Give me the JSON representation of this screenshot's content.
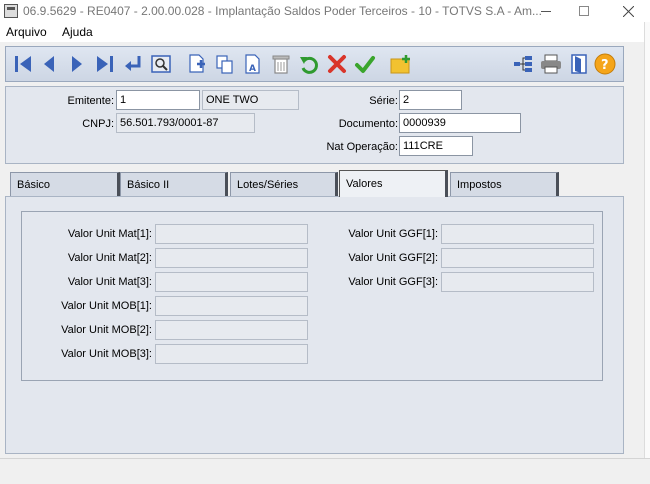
{
  "window": {
    "title": "06.9.5629 - RE0407 - 2.00.00.028 - Implantação Saldos Poder Terceiros - 10 - TOTVS S.A - Am..."
  },
  "menu": {
    "items": [
      "Arquivo",
      "Ajuda"
    ]
  },
  "toolbar": {
    "buttons": [
      "first-icon",
      "previous-icon",
      "next-icon",
      "last-icon",
      "goto-icon",
      "search-icon",
      "new-icon",
      "copy-icon",
      "edit-icon",
      "delete-icon",
      "undo-icon",
      "cancel-icon",
      "save-icon",
      "add-folder-icon",
      "hierarchy-icon",
      "print-icon",
      "exit-icon",
      "help-icon"
    ],
    "colors": {
      "nav": "#3a63b8",
      "undo": "#2f9a2f",
      "cancel": "#d9352a",
      "save": "#3aa52c",
      "help": "#f5a51a"
    }
  },
  "header": {
    "emitente_label": "Emitente:",
    "emitente_value": "1",
    "emitente_name": "ONE TWO",
    "cnpj_label": "CNPJ:",
    "cnpj_value": "56.501.793/0001-87",
    "serie_label": "Série:",
    "serie_value": "2",
    "documento_label": "Documento:",
    "documento_value": "0000939",
    "nat_operacao_label": "Nat Operação:",
    "nat_operacao_value": "111CRE"
  },
  "tabs": [
    {
      "label": "Básico"
    },
    {
      "label": "Básico II"
    },
    {
      "label": "Lotes/Séries"
    },
    {
      "label": "Valores",
      "active": true
    },
    {
      "label": "Impostos"
    }
  ],
  "valores": {
    "left": [
      {
        "label": "Valor Unit Mat[1]:",
        "value": ""
      },
      {
        "label": "Valor Unit Mat[2]:",
        "value": ""
      },
      {
        "label": "Valor Unit Mat[3]:",
        "value": ""
      },
      {
        "label": "Valor Unit MOB[1]:",
        "value": ""
      },
      {
        "label": "Valor Unit MOB[2]:",
        "value": ""
      },
      {
        "label": "Valor Unit MOB[3]:",
        "value": ""
      }
    ],
    "right": [
      {
        "label": "Valor Unit GGF[1]:",
        "value": ""
      },
      {
        "label": "Valor Unit GGF[2]:",
        "value": ""
      },
      {
        "label": "Valor Unit GGF[3]:",
        "value": ""
      }
    ]
  }
}
